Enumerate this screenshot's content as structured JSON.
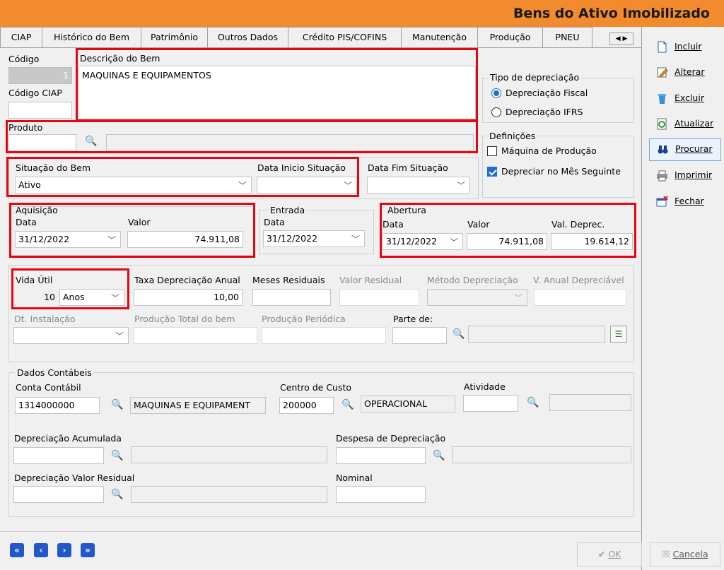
{
  "window": {
    "title": "Bens do Ativo Imobilizado"
  },
  "tabs": [
    "CIAP",
    "Histórico do Bem",
    "Patrimônio",
    "Outros Dados",
    "Crédito PIS/COFINS",
    "Manutenção",
    "Produção",
    "PNEU"
  ],
  "form": {
    "codigo_label": "Código",
    "codigo_value": "1",
    "codigo_ciap_label": "Código CIAP",
    "descricao_label": "Descrição do Bem",
    "descricao_value": "MAQUINAS E EQUIPAMENTOS",
    "produto_label": "Produto",
    "situacao_label": "Situação do Bem",
    "situacao_value": "Ativo",
    "data_inicio_label": "Data Inicio Situação",
    "data_fim_label": "Data Fim Situação",
    "aquisicao": {
      "group": "Aquisição",
      "data_label": "Data",
      "data_value": "31/12/2022",
      "valor_label": "Valor",
      "valor_value": "74.911,08"
    },
    "entrada": {
      "group": "Entrada",
      "data_label": "Data",
      "data_value": "31/12/2022"
    },
    "abertura": {
      "group": "Abertura",
      "data_label": "Data",
      "data_value": "31/12/2022",
      "valor_label": "Valor",
      "valor_value": "74.911,08",
      "valdeprec_label": "Val. Deprec.",
      "valdeprec_value": "19.614,12"
    },
    "vida_util_label": "Vida Útil",
    "vida_util_value": "10",
    "vida_util_unit": "Anos",
    "taxa_label": "Taxa Depreciação Anual",
    "taxa_value": "10,00",
    "meses_label": "Meses Residuais",
    "valor_residual_label": "Valor Residual",
    "metodo_label": "Método Depreciação",
    "v_anual_label": "V. Anual Depreciável",
    "dt_instalacao_label": "Dt. Instalação",
    "producao_total_label": "Produção Total do bem",
    "producao_periodica_label": "Produção Periódica",
    "parte_de_label": "Parte de:"
  },
  "tipo_depreciacao": {
    "group": "Tipo de depreciação",
    "options": [
      "Depreciação Fiscal",
      "Depreciação IFRS"
    ],
    "selected": 0
  },
  "definicoes": {
    "group": "Definições",
    "maquina_label": "Máquina de Produção",
    "maquina_checked": false,
    "depreciar_label": "Depreciar no Mês Seguinte",
    "depreciar_checked": true
  },
  "contabeis": {
    "group": "Dados Contábeis",
    "conta_label": "Conta Contábil",
    "conta_value": "1314000000",
    "conta_desc": "MAQUINAS E EQUIPAMENT",
    "centro_label": "Centro de Custo",
    "centro_value": "200000",
    "centro_desc": "OPERACIONAL",
    "atividade_label": "Atividade",
    "dep_acumulada_label": "Depreciação Acumulada",
    "despesa_label": "Despesa de Depreciação",
    "dep_residual_label": "Depreciação Valor Residual",
    "nominal_label": "Nominal"
  },
  "sidebar": {
    "incluir": "Incluir",
    "alterar": "Alterar",
    "excluir": "Excluir",
    "atualizar": "Atualizar",
    "procurar": "Procurar",
    "imprimir": "Imprimir",
    "fechar": "Fechar"
  },
  "footer": {
    "ok": "OK",
    "cancela": "Cancela"
  },
  "colors": {
    "title_bar": "#f28a2e",
    "highlight": "#e30613",
    "accent": "#1e6fd1"
  }
}
